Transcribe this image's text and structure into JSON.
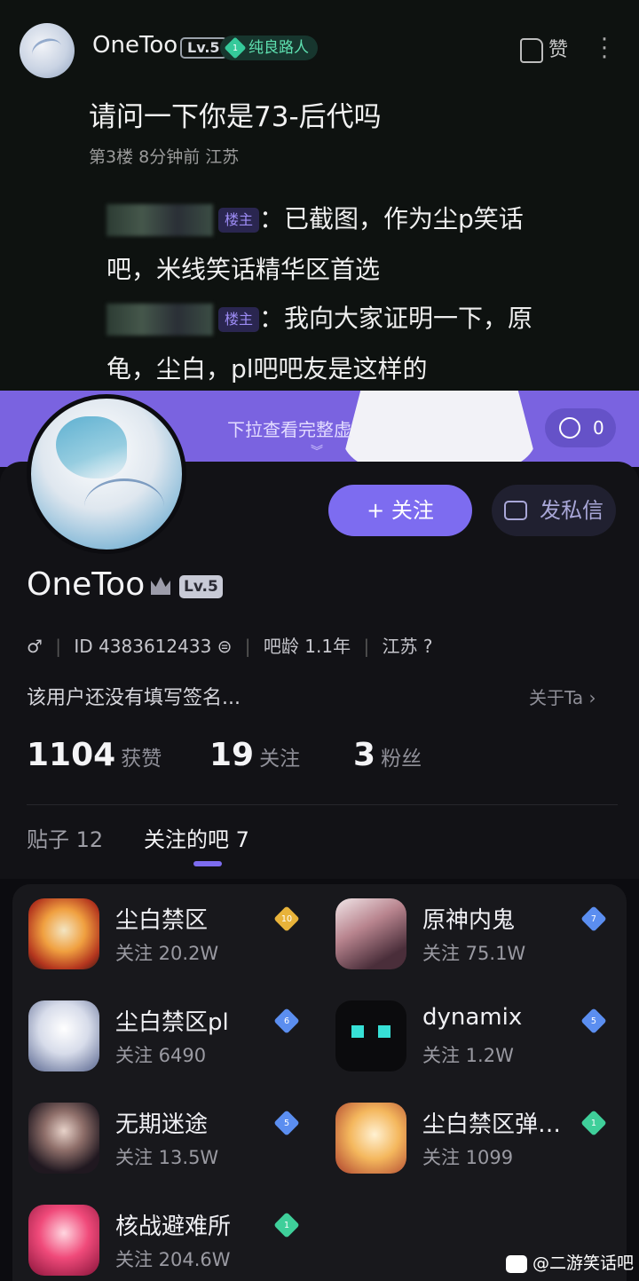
{
  "post": {
    "user_name": "OneToo",
    "level": "Lv.5",
    "rank_number": "1",
    "rank_title": "纯良路人",
    "like_label": "赞",
    "content": "请问一下你是73-后代吗",
    "meta": "第3楼  8分钟前  江苏",
    "replies": [
      {
        "host_tag": "楼主",
        "text_line1": "：已截图，作为尘p笑话",
        "text_line2": "吧，米线笑话精华区首选"
      },
      {
        "host_tag": "楼主",
        "text_line1": "：我向大家证明一下，原",
        "text_line2": "龟，尘白，pl吧吧友是这样的"
      }
    ]
  },
  "banner": {
    "hint": "下拉查看完整虚",
    "chevron": "︾",
    "reaction_count": "0"
  },
  "profile": {
    "follow_label": "+ 关注",
    "message_label": "发私信",
    "name": "OneToo",
    "level": "Lv.5",
    "gender_icon": "♂",
    "id_text": "ID 4383612433",
    "age_text": "吧龄 1.1年",
    "location": "江苏",
    "signature": "该用户还没有填写签名...",
    "about_label": "关于Ta ›",
    "stats": [
      {
        "number": "1104",
        "label": "获赞"
      },
      {
        "number": "19",
        "label": "关注"
      },
      {
        "number": "3",
        "label": "粉丝"
      }
    ],
    "tabs": [
      {
        "label": "贴子 12"
      },
      {
        "label": "关注的吧 7"
      }
    ]
  },
  "bars": [
    {
      "name": "尘白禁区",
      "followers": "关注 20.2W",
      "level": "10",
      "gem_color": "#e8b33a"
    },
    {
      "name": "原神内鬼",
      "followers": "关注 75.1W",
      "level": "7",
      "gem_color": "#5b8ef0"
    },
    {
      "name": "尘白禁区pl",
      "followers": "关注 6490",
      "level": "6",
      "gem_color": "#5b8ef0"
    },
    {
      "name": "dynamix",
      "followers": "关注 1.2W",
      "level": "5",
      "gem_color": "#5b8ef0"
    },
    {
      "name": "无期迷途",
      "followers": "关注 13.5W",
      "level": "5",
      "gem_color": "#5b8ef0"
    },
    {
      "name": "尘白禁区弹…",
      "followers": "关注 1099",
      "level": "1",
      "gem_color": "#3fcf9a"
    },
    {
      "name": "核战避难所",
      "followers": "关注 204.6W",
      "level": "1",
      "gem_color": "#3fcf9a"
    }
  ],
  "watermark": "@二游笑话吧",
  "colors": {
    "accent": "#7d6cf0",
    "banner": "#7a63e0",
    "background": "#0c0c10"
  }
}
